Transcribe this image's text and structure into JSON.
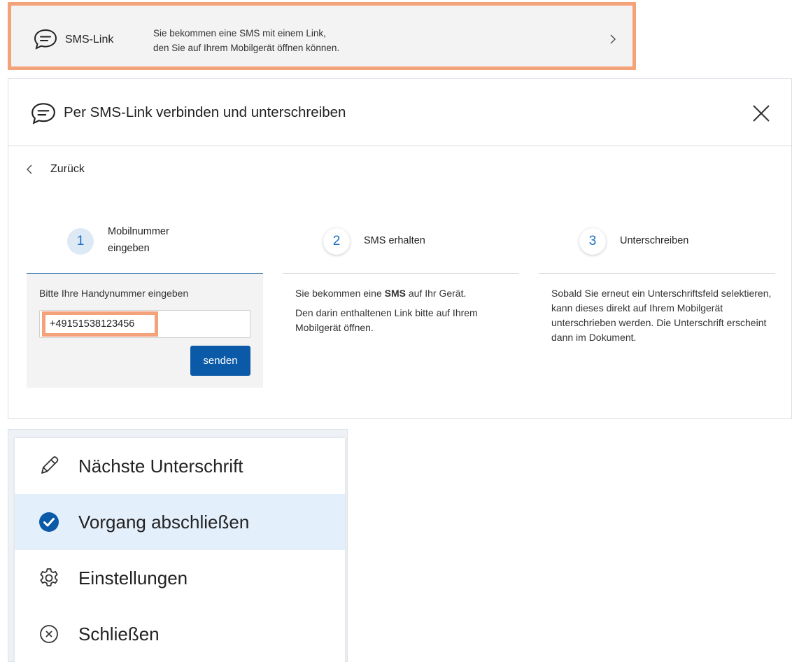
{
  "option_card": {
    "title": "SMS-Link",
    "description_line1": "Sie bekommen eine SMS mit einem Link,",
    "description_line2": "den Sie auf Ihrem Mobilgerät öffnen können.",
    "icon": "chat-bubble-icon",
    "highlight_color": "#f4a27a"
  },
  "dialog": {
    "title": "Per SMS-Link verbinden und unterschreiben",
    "back_label": "Zurück",
    "steps": [
      {
        "number": "1",
        "label_line1": "Mobilnummer",
        "label_line2": "eingeben",
        "active": true,
        "input_label": "Bitte Ihre Handynummer eingeben",
        "input_value": "+49151538123456",
        "send_label": "senden"
      },
      {
        "number": "2",
        "label": "SMS erhalten",
        "text1_before": "Sie bekommen eine ",
        "text1_bold": "SMS",
        "text1_after": " auf Ihr Gerät.",
        "text2": "Den darin enthaltenen Link bitte auf Ihrem Mobilgerät öffnen."
      },
      {
        "number": "3",
        "label": "Unterschreiben",
        "text": "Sobald Sie erneut ein Unterschriftsfeld selektieren, kann dieses direkt auf Ihrem Mobilgerät unterschrieben werden. Die Unterschrift erscheint dann im Dokument."
      }
    ],
    "accent_color": "#0b5aa8"
  },
  "menu": {
    "items": [
      {
        "label": "Nächste Unterschrift",
        "icon": "pencil-icon",
        "selected": false
      },
      {
        "label": "Vorgang abschließen",
        "icon": "check-circle-icon",
        "selected": true
      },
      {
        "label": "Einstellungen",
        "icon": "gear-icon",
        "selected": false
      },
      {
        "label": "Schließen",
        "icon": "close-circle-icon",
        "selected": false
      }
    ],
    "selected_bg": "#e3effb"
  }
}
